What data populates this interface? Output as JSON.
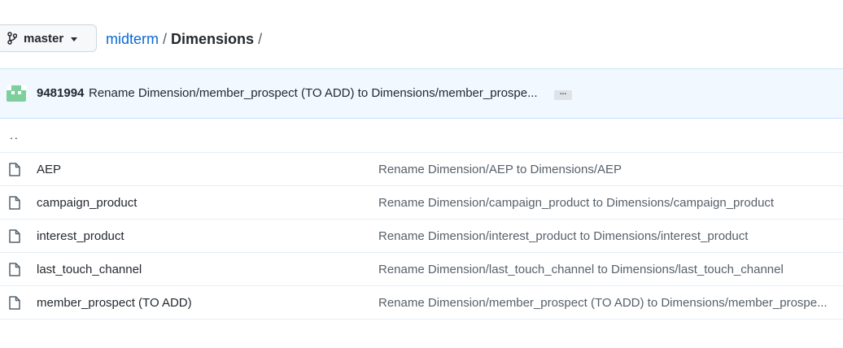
{
  "branch": {
    "label": "master"
  },
  "breadcrumb": {
    "repo": "midterm",
    "sep1": "/",
    "folder": "Dimensions",
    "sep2": "/"
  },
  "commit": {
    "sha": "9481994",
    "message": "Rename Dimension/member_prospect (TO ADD) to Dimensions/member_prospe...",
    "ellipsis": "..."
  },
  "parent": {
    "label": ".."
  },
  "files": [
    {
      "name": "AEP",
      "message": "Rename Dimension/AEP to Dimensions/AEP"
    },
    {
      "name": "campaign_product",
      "message": "Rename Dimension/campaign_product to Dimensions/campaign_product"
    },
    {
      "name": "interest_product",
      "message": "Rename Dimension/interest_product to Dimensions/interest_product"
    },
    {
      "name": "last_touch_channel",
      "message": "Rename Dimension/last_touch_channel to Dimensions/last_touch_channel"
    },
    {
      "name": "member_prospect (TO ADD)",
      "message": "Rename Dimension/member_prospect (TO ADD) to Dimensions/member_prospe..."
    }
  ],
  "colors": {
    "link": "#0969da",
    "commit_bg": "#f1f8ff",
    "avatar": "#7fcf9d"
  },
  "icons": {
    "branch": "git-branch-icon",
    "file": "file-icon",
    "avatar": "identicon-avatar"
  }
}
